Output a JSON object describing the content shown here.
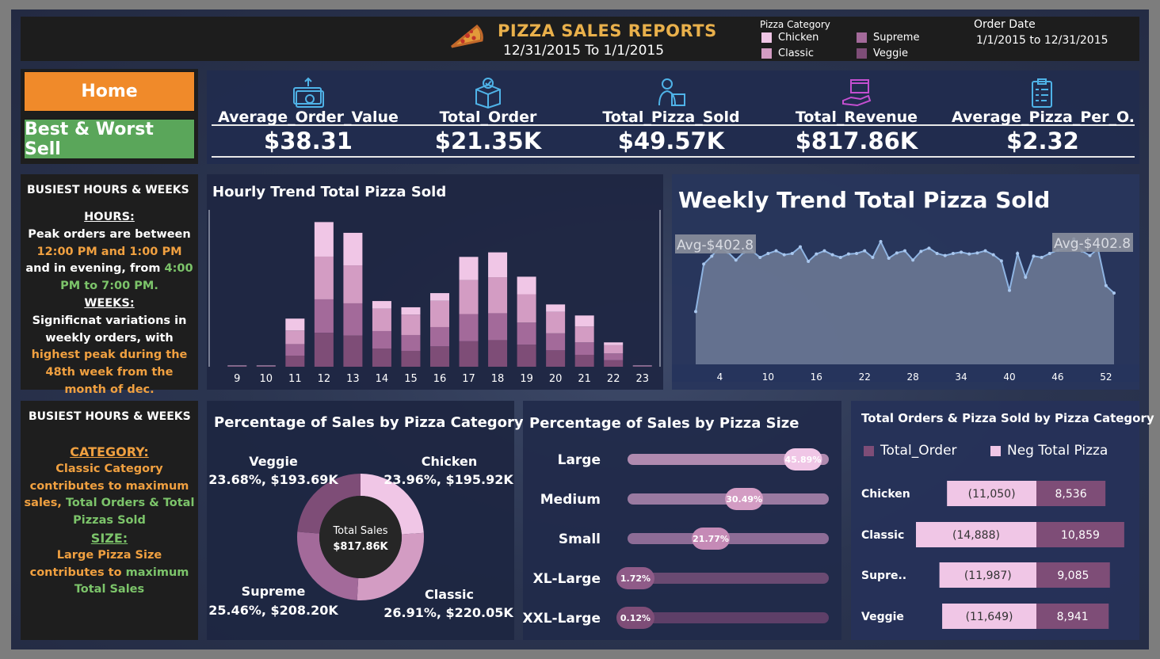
{
  "header": {
    "title": "PIZZA SALES REPORTS",
    "subtitle": "12/31/2015 To 1/1/2015",
    "legend_title": "Pizza Category",
    "legend": [
      {
        "label": "Chicken",
        "color": "#f0c6e6"
      },
      {
        "label": "Classic",
        "color": "#d39cc3"
      },
      {
        "label": "Supreme",
        "color": "#a36a9a"
      },
      {
        "label": "Veggie",
        "color": "#7e4d77"
      }
    ],
    "order_date_label": "Order Date",
    "order_date_value": "1/1/2015 to 12/31/2015"
  },
  "nav": {
    "home_label": "Home",
    "best_worst_label": "Best & Worst Sell"
  },
  "kpis": [
    {
      "label": "Average_Order_Value",
      "value": "$38.31",
      "icon": "money-icon"
    },
    {
      "label": "Total_Order",
      "value": "$21.35K",
      "icon": "box-icon"
    },
    {
      "label": "Total_Pizza_Sold",
      "value": "$49.57K",
      "icon": "delivery-icon"
    },
    {
      "label": "Total_Revenue",
      "value": "$817.86K",
      "icon": "revenue-hand-icon"
    },
    {
      "label": "Average_Pizza_Per_O..",
      "value": "$2.32",
      "icon": "clipboard-icon"
    }
  ],
  "insight_top": {
    "heading": "BUSIEST HOURS & WEEKS",
    "hours_label": "HOURS:",
    "hours_text_1": "Peak orders are between",
    "hours_highlight_1": "12:00 PM and 1:00 PM",
    "hours_text_2": " and in evening, from ",
    "hours_highlight_2": "4:00 PM to 7:00 PM.",
    "weeks_label": "WEEKS:",
    "weeks_text_1": "Significnat variations in weekly orders, with ",
    "weeks_highlight": "highest peak during the 48th week from the month of dec."
  },
  "insight_bottom": {
    "heading": "BUSIEST HOURS & WEEKS",
    "category_label": "CATEGORY:",
    "category_text_1": "Classic Category contributes to maximum sales, ",
    "category_highlight": "Total Orders & Total Pizzas Sold",
    "size_label": "SIZE:",
    "size_text_1": "Large Pizza Size contributes to ",
    "size_text_2": "maximum",
    "size_highlight": "Total Sales"
  },
  "chart_data": [
    {
      "id": "hourly",
      "type": "bar",
      "stacked": true,
      "title": "Hourly Trend Total Pizza Sold",
      "categories": [
        "9",
        "10",
        "11",
        "12",
        "13",
        "14",
        "15",
        "16",
        "17",
        "18",
        "19",
        "20",
        "21",
        "22",
        "23"
      ],
      "series": [
        {
          "name": "Veggie",
          "color": "#7e4d77",
          "values": [
            1,
            5,
            390,
            1200,
            1100,
            640,
            560,
            720,
            900,
            940,
            780,
            580,
            420,
            230,
            5
          ]
        },
        {
          "name": "Supreme",
          "color": "#a36a9a",
          "values": [
            1,
            5,
            410,
            1180,
            1140,
            620,
            560,
            680,
            960,
            950,
            780,
            600,
            440,
            240,
            6
          ]
        },
        {
          "name": "Classic",
          "color": "#d39cc3",
          "values": [
            1,
            6,
            480,
            1510,
            1340,
            790,
            720,
            930,
            1200,
            1270,
            1000,
            760,
            560,
            290,
            8
          ]
        },
        {
          "name": "Chicken",
          "color": "#f0c6e6",
          "values": [
            1,
            4,
            420,
            1220,
            1150,
            270,
            260,
            270,
            820,
            880,
            620,
            260,
            390,
            100,
            5
          ]
        }
      ],
      "ylim": [
        0,
        5400
      ]
    },
    {
      "id": "weekly",
      "type": "area",
      "title": "Weekly Trend Total Pizza Sold",
      "x_ticks": [
        4,
        10,
        16,
        22,
        28,
        34,
        40,
        46,
        52
      ],
      "x": [
        1,
        2,
        3,
        4,
        5,
        6,
        7,
        8,
        9,
        10,
        11,
        12,
        13,
        14,
        15,
        16,
        17,
        18,
        19,
        20,
        21,
        22,
        23,
        24,
        25,
        26,
        27,
        28,
        29,
        30,
        31,
        32,
        33,
        34,
        35,
        36,
        37,
        38,
        39,
        40,
        41,
        42,
        43,
        44,
        45,
        46,
        47,
        48,
        49,
        50,
        51,
        52,
        53
      ],
      "y": [
        200,
        380,
        410,
        445,
        425,
        395,
        425,
        430,
        405,
        420,
        430,
        415,
        420,
        445,
        390,
        418,
        430,
        415,
        405,
        418,
        420,
        430,
        405,
        465,
        402,
        422,
        430,
        395,
        428,
        440,
        420,
        412,
        420,
        425,
        418,
        422,
        430,
        415,
        392,
        280,
        420,
        330,
        410,
        405,
        420,
        432,
        440,
        475,
        430,
        412,
        438,
        298,
        270
      ],
      "ylim": [
        0,
        600
      ],
      "reference_line": {
        "label": "Avg-$402.8",
        "value": 402.8
      }
    },
    {
      "id": "category_pie",
      "type": "pie",
      "donut": true,
      "title": "Percentage of Sales by Pizza Category",
      "center_label": "Total Sales",
      "center_value": "$817.86K",
      "slices": [
        {
          "name": "Chicken",
          "percent": 23.96,
          "value_label": "23.96%, $195.92K",
          "color": "#f0c6e6"
        },
        {
          "name": "Classic",
          "percent": 26.91,
          "value_label": "26.91%, $220.05K",
          "color": "#d39cc3"
        },
        {
          "name": "Supreme",
          "percent": 25.46,
          "value_label": "25.46%, $208.20K",
          "color": "#a36a9a"
        },
        {
          "name": "Veggie",
          "percent": 23.68,
          "value_label": "23.68%, $193.69K",
          "color": "#7e4d77"
        }
      ]
    },
    {
      "id": "size",
      "type": "bar",
      "orientation": "horizontal",
      "title": "Percentage of Sales by Pizza Size",
      "categories": [
        "Large",
        "Medium",
        "Small",
        "XL-Large",
        "XXL-Large"
      ],
      "values": [
        45.89,
        30.49,
        21.77,
        1.72,
        0.12
      ],
      "labels": [
        "45.89%",
        "30.49%",
        "21.77%",
        "1.72%",
        "0.12%"
      ],
      "xlim": [
        0,
        100
      ]
    },
    {
      "id": "orders_by_category",
      "type": "bar",
      "orientation": "horizontal",
      "diverging": true,
      "title": "Total Orders & Pizza Sold by Pizza Category",
      "categories": [
        "Chicken",
        "Classic",
        "Supre..",
        "Veggie"
      ],
      "series": [
        {
          "name": "Total_Order",
          "color": "#7e4d77",
          "values": [
            8536,
            10859,
            9085,
            8941
          ],
          "labels": [
            "8,536",
            "10,859",
            "9,085",
            "8,941"
          ]
        },
        {
          "name": "Neg Total Pizza",
          "color": "#f0c6e6",
          "values": [
            -11050,
            -14888,
            -11987,
            -11649
          ],
          "labels": [
            "(11,050)",
            "(14,888)",
            "(11,987)",
            "(11,649)"
          ]
        }
      ]
    }
  ]
}
